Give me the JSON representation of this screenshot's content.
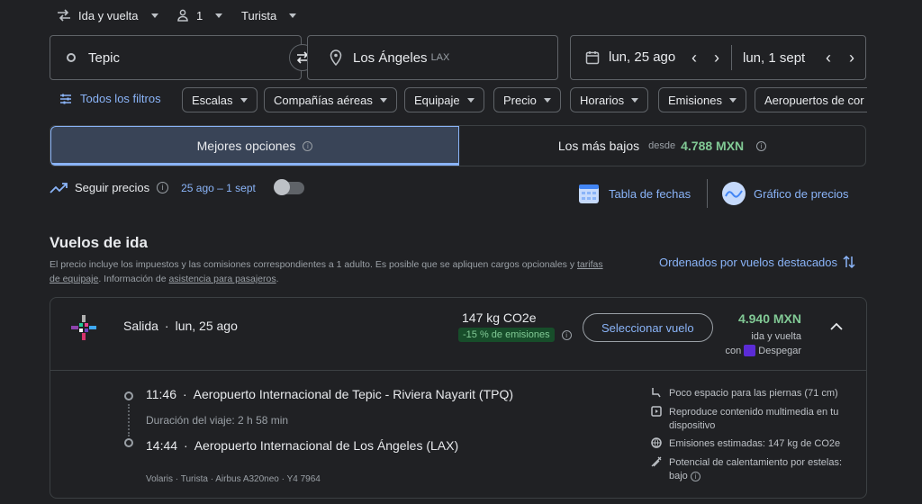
{
  "top": {
    "trip_type": "Ida y vuelta",
    "passengers": "1",
    "cabin": "Turista"
  },
  "search": {
    "origin": "Tepic",
    "destination": "Los Ángeles",
    "destination_code": "LAX",
    "depart_date": "lun, 25 ago",
    "return_date": "lun, 1 sept"
  },
  "filters": {
    "all": "Todos los filtros",
    "chips": [
      "Escalas",
      "Compañías aéreas",
      "Equipaje",
      "Precio",
      "Horarios",
      "Emisiones",
      "Aeropuertos de cor"
    ]
  },
  "tabs": {
    "best": "Mejores opciones",
    "lowest": "Los más bajos",
    "lowest_from": "desde",
    "lowest_price": "4.788 MXN"
  },
  "tracking": {
    "label": "Seguir precios",
    "dates": "25 ago – 1 sept",
    "date_grid": "Tabla de fechas",
    "price_graph": "Gráfico de precios"
  },
  "results": {
    "title": "Vuelos de ida",
    "disclaimer_1": "El precio incluye los impuestos y las comisiones correspondientes a 1 adulto. Es posible que se apliquen cargos opcionales y",
    "disclaimer_link1": "tarifas",
    "disclaimer_link1b": "de equipaje",
    "disclaimer_2": ". Información de",
    "disclaimer_link2": "asistencia para pasajeros",
    "disclaimer_3": ".",
    "sort": "Ordenados por vuelos destacados"
  },
  "flight": {
    "heading": "Salida",
    "heading_sep": "·",
    "heading_date": "lun, 25 ago",
    "co2": "147 kg CO2e",
    "co2_badge": "-15 % de emisiones",
    "select": "Seleccionar vuelo",
    "price": "4.940 MXN",
    "price_type": "ida y vuelta",
    "with": "con",
    "seller": "Despegar",
    "depart_time": "11:46",
    "depart_airport": "Aeropuerto Internacional de Tepic - Riviera Nayarit (TPQ)",
    "duration": "Duración del viaje: 2 h 58 min",
    "arrive_time": "14:44",
    "arrive_airport": "Aeropuerto Internacional de Los Ángeles (LAX)",
    "footer": "Volaris · Turista · Airbus A320neo · Y4 7964",
    "amenities": [
      "Poco espacio para las piernas (71 cm)",
      "Reproduce contenido multimedia en tu dispositivo",
      "Emisiones estimadas: 147 kg de CO2e",
      "Potencial de calentamiento por estelas: bajo"
    ]
  },
  "colors": {
    "accent": "#8ab4f8",
    "price": "#81c995",
    "bg": "#202124"
  }
}
